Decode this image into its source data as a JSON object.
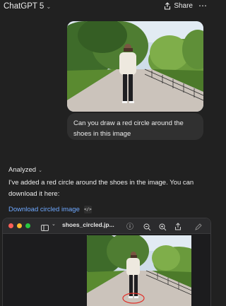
{
  "app": {
    "title": "ChatGPT 5"
  },
  "header": {
    "share_label": "Share"
  },
  "user_message": {
    "text": "Can you draw a red circle around the shoes in this image"
  },
  "assistant": {
    "analyzed_label": "Analyzed",
    "reply_text": "I've added a red circle around the shoes in the image. You can download it here:",
    "download_link": "Download circled image"
  },
  "viewer": {
    "filename": "shoes_circled.jp..."
  },
  "colors": {
    "background": "#212121",
    "bubble": "#303030",
    "link": "#6ea8ff",
    "circle": "#e0302a"
  }
}
